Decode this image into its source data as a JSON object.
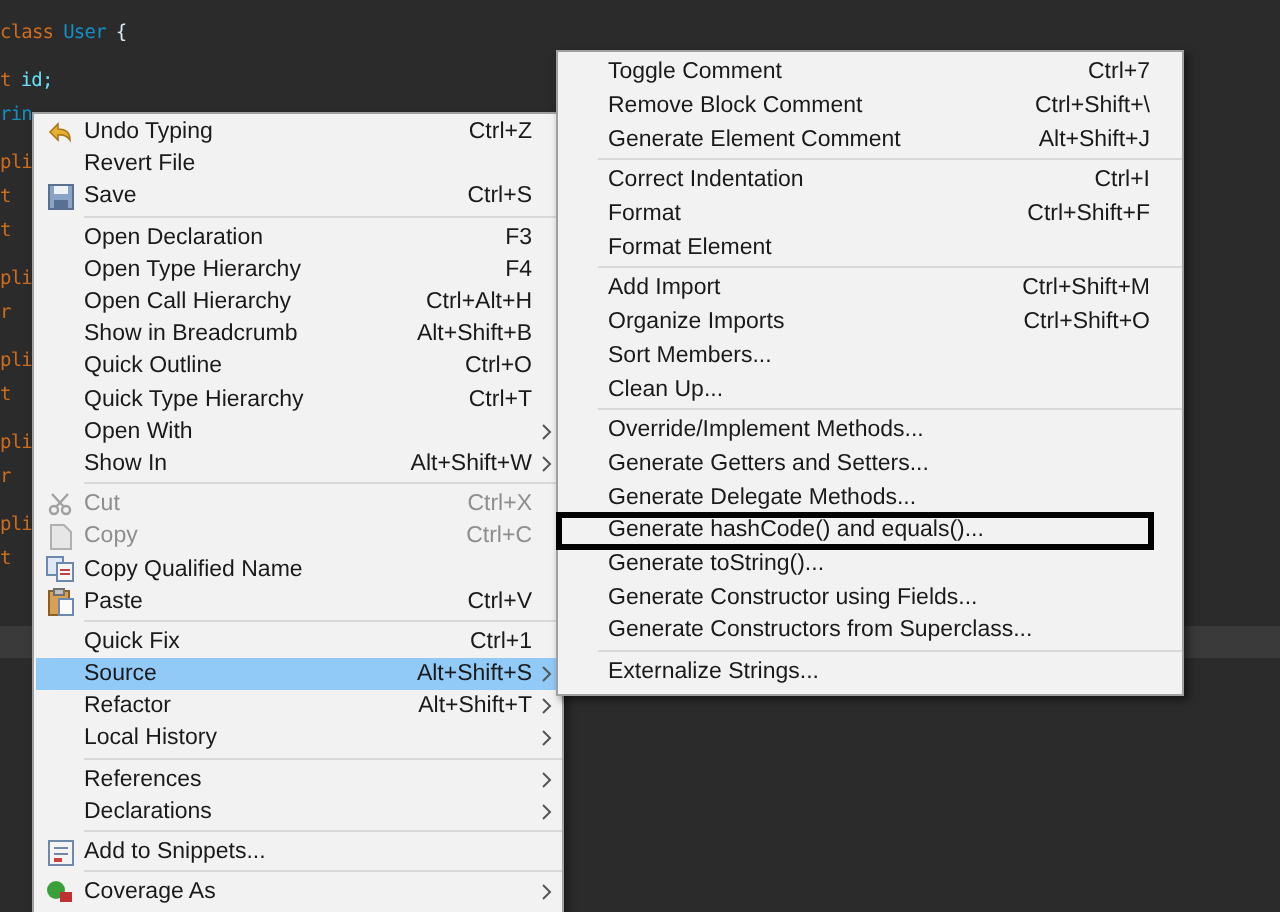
{
  "editor": {
    "code_groups": [
      [
        [
          {
            "text": "class",
            "kind": "keyword"
          },
          {
            "text": "User",
            "kind": "type"
          },
          {
            "text": "{",
            "kind": "plain"
          }
        ]
      ],
      [
        [
          {
            "text": "t",
            "kind": "keyword"
          },
          {
            "text": "id;",
            "kind": "field"
          }
        ],
        [
          {
            "text": "rin",
            "kind": "type"
          }
        ]
      ],
      [
        [
          {
            "text": "pli",
            "kind": "keyword"
          }
        ],
        [
          {
            "text": "t",
            "kind": "keyword"
          }
        ],
        [
          {
            "text": "t",
            "kind": "keyword"
          }
        ]
      ],
      [
        [
          {
            "text": "pli",
            "kind": "keyword"
          }
        ],
        [
          {
            "text": "r",
            "kind": "keyword"
          }
        ]
      ],
      [
        [
          {
            "text": "pli",
            "kind": "keyword"
          }
        ],
        [
          {
            "text": "t",
            "kind": "keyword"
          }
        ]
      ],
      [
        [
          {
            "text": "pli",
            "kind": "keyword"
          }
        ],
        [
          {
            "text": "r",
            "kind": "keyword"
          }
        ]
      ],
      [
        [
          {
            "text": "pli",
            "kind": "keyword"
          }
        ],
        [
          {
            "text": "t",
            "kind": "keyword"
          }
        ]
      ]
    ]
  },
  "context_menu": {
    "groups": [
      [
        {
          "label": "Undo Typing",
          "shortcut": "Ctrl+Z",
          "submenu": false,
          "disabled": false,
          "selected": false
        },
        {
          "label": "Revert File",
          "submenu": false,
          "disabled": false,
          "selected": false
        },
        {
          "label": "Save",
          "shortcut": "Ctrl+S",
          "submenu": false,
          "disabled": false,
          "selected": false
        }
      ],
      [
        {
          "label": "Open Declaration",
          "shortcut": "F3",
          "submenu": false,
          "disabled": false,
          "selected": false
        },
        {
          "label": "Open Type Hierarchy",
          "shortcut": "F4",
          "submenu": false,
          "disabled": false,
          "selected": false
        },
        {
          "label": "Open Call Hierarchy",
          "shortcut": "Ctrl+Alt+H",
          "submenu": false,
          "disabled": false,
          "selected": false
        },
        {
          "label": "Show in Breadcrumb",
          "shortcut": "Alt+Shift+B",
          "submenu": false,
          "disabled": false,
          "selected": false
        },
        {
          "label": "Quick Outline",
          "shortcut": "Ctrl+O",
          "submenu": false,
          "disabled": false,
          "selected": false
        },
        {
          "label": "Quick Type Hierarchy",
          "shortcut": "Ctrl+T",
          "submenu": false,
          "disabled": false,
          "selected": false
        },
        {
          "label": "Open With",
          "submenu": true,
          "disabled": false,
          "selected": false
        },
        {
          "label": "Show In",
          "shortcut": "Alt+Shift+W",
          "submenu": true,
          "disabled": false,
          "selected": false
        }
      ],
      [
        {
          "label": "Cut",
          "shortcut": "Ctrl+X",
          "submenu": false,
          "disabled": true,
          "selected": false
        },
        {
          "label": "Copy",
          "shortcut": "Ctrl+C",
          "submenu": false,
          "disabled": true,
          "selected": false
        },
        {
          "label": "Copy Qualified Name",
          "submenu": false,
          "disabled": false,
          "selected": false
        },
        {
          "label": "Paste",
          "shortcut": "Ctrl+V",
          "submenu": false,
          "disabled": false,
          "selected": false
        }
      ],
      [
        {
          "label": "Quick Fix",
          "shortcut": "Ctrl+1",
          "submenu": false,
          "disabled": false,
          "selected": false
        },
        {
          "label": "Source",
          "shortcut": "Alt+Shift+S",
          "submenu": true,
          "disabled": false,
          "selected": true
        },
        {
          "label": "Refactor",
          "shortcut": "Alt+Shift+T",
          "submenu": true,
          "disabled": false,
          "selected": false
        },
        {
          "label": "Local History",
          "submenu": true,
          "disabled": false,
          "selected": false
        }
      ],
      [
        {
          "label": "References",
          "submenu": true,
          "disabled": false,
          "selected": false
        },
        {
          "label": "Declarations",
          "submenu": true,
          "disabled": false,
          "selected": false
        }
      ],
      [
        {
          "label": "Add to Snippets...",
          "submenu": false,
          "disabled": false,
          "selected": false
        }
      ],
      [
        {
          "label": "Coverage As",
          "submenu": true,
          "disabled": false,
          "selected": false
        }
      ]
    ]
  },
  "source_submenu": {
    "groups": [
      [
        {
          "label": "Toggle Comment",
          "shortcut": "Ctrl+7",
          "outlined": false
        },
        {
          "label": "Remove Block Comment",
          "shortcut": "Ctrl+Shift+\\",
          "outlined": false
        },
        {
          "label": "Generate Element Comment",
          "shortcut": "Alt+Shift+J",
          "outlined": false
        }
      ],
      [
        {
          "label": "Correct Indentation",
          "shortcut": "Ctrl+I",
          "outlined": false
        },
        {
          "label": "Format",
          "shortcut": "Ctrl+Shift+F",
          "outlined": false
        },
        {
          "label": "Format Element",
          "outlined": false
        }
      ],
      [
        {
          "label": "Add Import",
          "shortcut": "Ctrl+Shift+M",
          "outlined": false
        },
        {
          "label": "Organize Imports",
          "shortcut": "Ctrl+Shift+O",
          "outlined": false
        },
        {
          "label": "Sort Members...",
          "outlined": false
        },
        {
          "label": "Clean Up...",
          "outlined": false
        }
      ],
      [
        {
          "label": "Override/Implement Methods...",
          "outlined": false
        },
        {
          "label": "Generate Getters and Setters...",
          "outlined": false
        },
        {
          "label": "Generate Delegate Methods...",
          "outlined": false
        },
        {
          "label": "Generate hashCode() and equals()...",
          "outlined": true
        },
        {
          "label": "Generate toString()...",
          "outlined": false
        },
        {
          "label": "Generate Constructor using Fields...",
          "outlined": false
        },
        {
          "label": "Generate Constructors from Superclass...",
          "outlined": false
        }
      ],
      [
        {
          "label": "Externalize Strings...",
          "outlined": false
        }
      ]
    ]
  }
}
